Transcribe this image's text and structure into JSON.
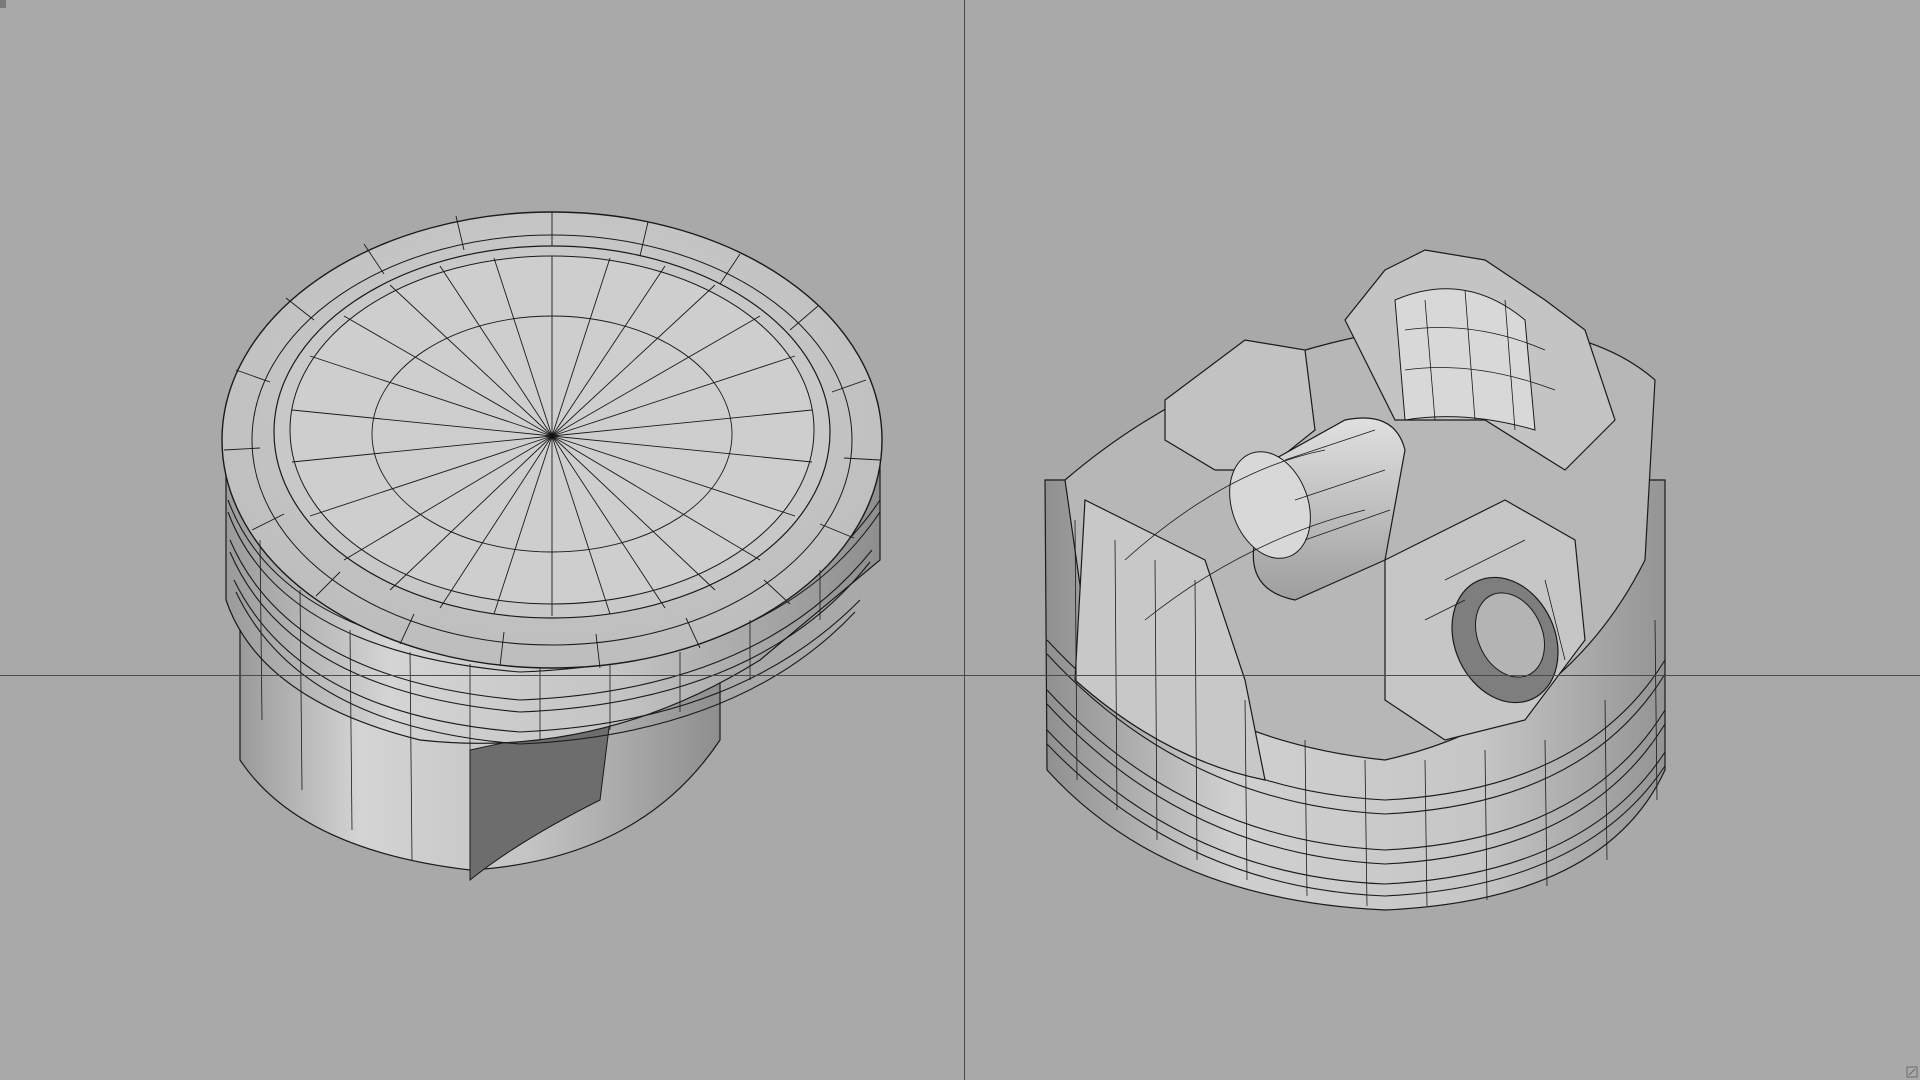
{
  "app": {
    "layout": "two-viewport-split",
    "background_color": "#a9a9a9",
    "divider_color": "#4a4a4a",
    "mesh_line_color": "#1a1a1a",
    "surface_color": "#c9c9c9"
  },
  "viewports": [
    {
      "view": "perspective",
      "model": "piston-crown-top"
    },
    {
      "view": "perspective",
      "model": "piston-underside"
    }
  ]
}
